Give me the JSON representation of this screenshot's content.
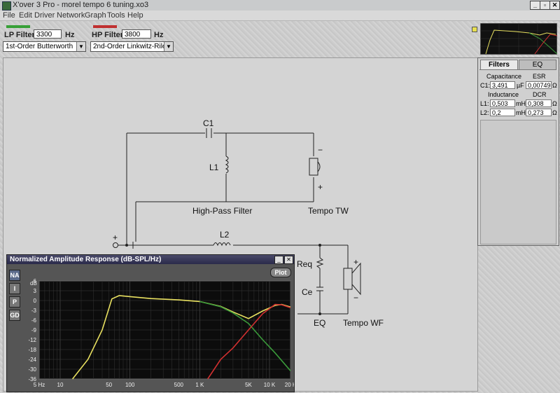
{
  "window": {
    "title": "X'over 3 Pro  -  morel tempo 6 tuning.xo3",
    "minimize": "_",
    "maximize": "▫",
    "close": "✕"
  },
  "menu": [
    "File",
    "Edit",
    "Driver",
    "Network",
    "Graph",
    "Tools",
    "Help"
  ],
  "lp": {
    "label": "LP Filter:",
    "value": "3300",
    "unit": "Hz",
    "type": "1st-Order Butterworth",
    "color": "#37a037"
  },
  "hp": {
    "label": "HP Filter:",
    "value": "3800",
    "unit": "Hz",
    "type": "2nd-Order Linkwitz-Riley",
    "color": "#c03030"
  },
  "panel": {
    "tabs": [
      "Filters",
      "EQ"
    ],
    "cap_header": "Capacitance",
    "esr_header": "ESR",
    "c1": {
      "label": "C1:",
      "value": "3,491",
      "unit": "µF",
      "esr": "0,00749",
      "ohm": "Ω"
    },
    "ind_header": "Inductance",
    "dcr_header": "DCR",
    "l1": {
      "label": "L1:",
      "value": "0,503",
      "unit": "mH",
      "dcr": "0,308",
      "ohm": "Ω"
    },
    "l2": {
      "label": "L2:",
      "value": "0,2",
      "unit": "mH",
      "dcr": "0,273",
      "ohm": "Ω"
    }
  },
  "schematic": {
    "c1": "C1",
    "l1": "L1",
    "l2": "L2",
    "req": "Req",
    "ce": "Ce",
    "hp_filter": "High-Pass Filter",
    "tw": "Tempo TW",
    "eq": "EQ",
    "wf": "Tempo WF",
    "plus": "+",
    "minus": "−"
  },
  "graph": {
    "title": "Normalized Amplitude Response (dB-SPL/Hz)",
    "plot_button": "Plot",
    "side_buttons": [
      "NA",
      "I",
      "P",
      "GD"
    ],
    "unit_label": "dB"
  },
  "chart_data": {
    "type": "line",
    "title": "Normalized Amplitude Response (dB-SPL/Hz)",
    "xlabel": "",
    "ylabel": "dB",
    "x_scale": "log",
    "xlim": [
      5,
      20000
    ],
    "ylim": [
      -36,
      6
    ],
    "x_ticks": [
      "5 Hz",
      "10",
      "50",
      "100",
      "500",
      "1 K",
      "5K",
      "10 K",
      "20 K"
    ],
    "y_ticks": [
      "6",
      "3",
      "0",
      "-3",
      "-6",
      "-9",
      "-12",
      "-18",
      "-24",
      "-30",
      "-36"
    ],
    "grid": true,
    "series": [
      {
        "color": "#e8e060",
        "x": [
          15,
          25,
          40,
          55,
          70,
          100,
          200,
          500,
          1000,
          2000,
          3000,
          5000,
          8000,
          12000,
          15000,
          20000
        ],
        "y": [
          -36,
          -24,
          -9,
          0.5,
          1.5,
          1.2,
          0.6,
          0.2,
          -0.3,
          -1.8,
          -3.5,
          -5.5,
          -3.2,
          -1.5,
          -1.2,
          -2
        ]
      },
      {
        "color": "#3a9a3a",
        "x": [
          1000,
          2000,
          3000,
          5000,
          8000,
          12000,
          20000
        ],
        "y": [
          -0.3,
          -1.9,
          -3.8,
          -7,
          -12,
          -20,
          -31
        ]
      },
      {
        "color": "#d03030",
        "x": [
          1300,
          2000,
          3000,
          5000,
          8000,
          12000,
          15000,
          20000
        ],
        "y": [
          -36,
          -24,
          -17,
          -9,
          -4,
          -1.2,
          -1.3,
          -2.2
        ]
      }
    ]
  },
  "mini_graph": {
    "visible": true
  }
}
